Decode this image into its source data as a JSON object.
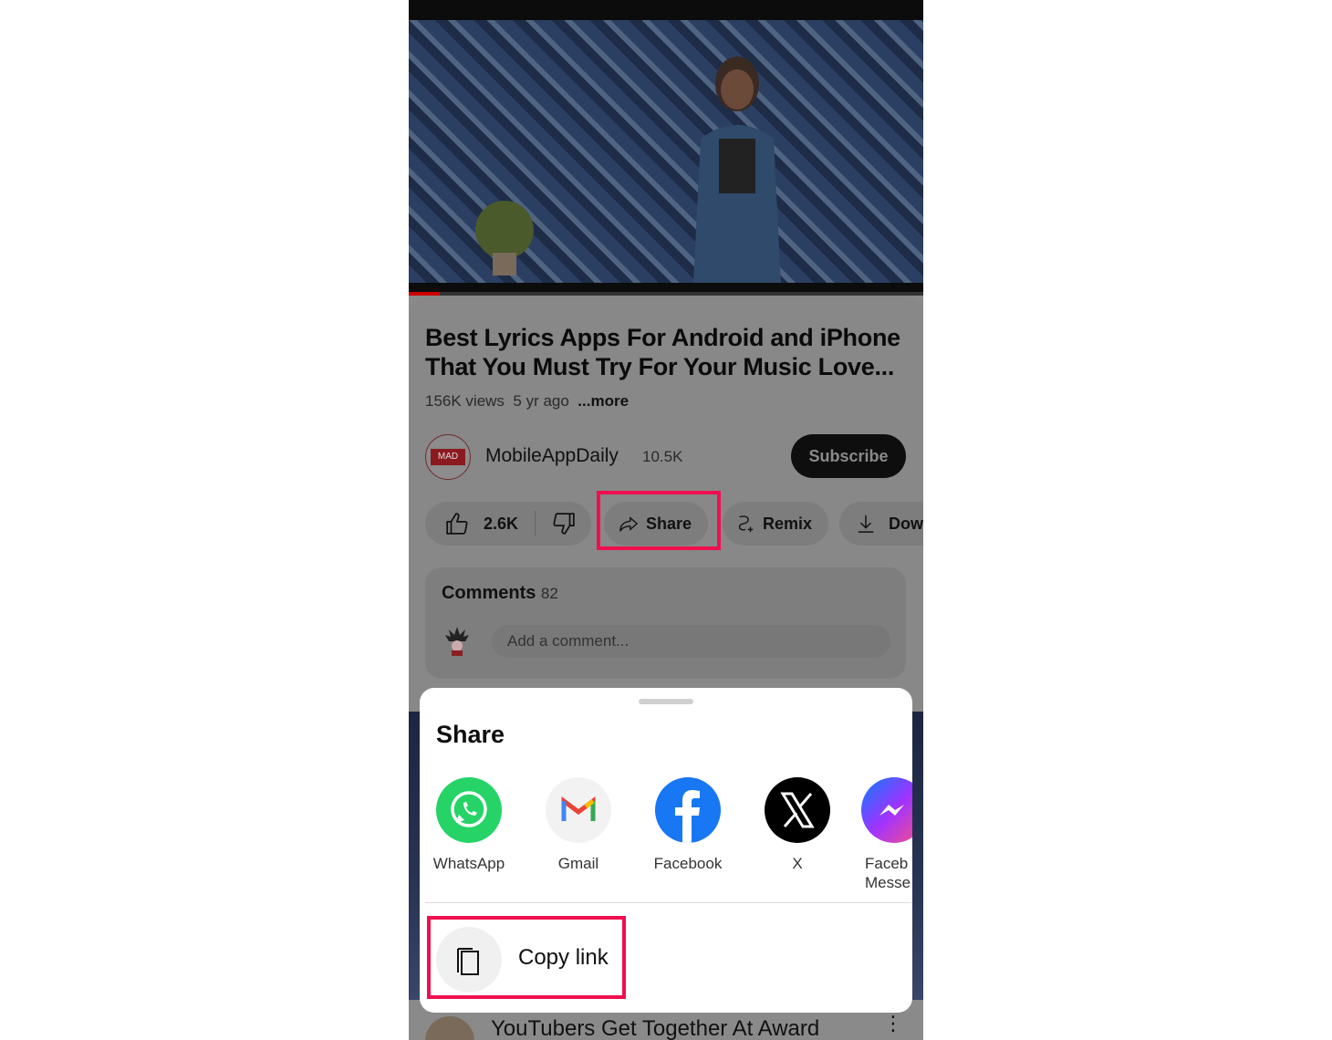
{
  "video": {
    "progress_percent": 6
  },
  "details": {
    "title": "Best Lyrics Apps For Android and iPhone That You Must Try For Your Music Love...",
    "views": "156K views",
    "age": "5 yr ago",
    "more": "...more"
  },
  "channel": {
    "logo_text": "MAD",
    "name": "MobileAppDaily",
    "subscribers": "10.5K",
    "subscribe_label": "Subscribe"
  },
  "actions": {
    "likes": "2.6K",
    "share": "Share",
    "remix": "Remix",
    "download": "Dow"
  },
  "comments": {
    "label": "Comments",
    "count": "82",
    "placeholder": "Add a comment..."
  },
  "share_sheet": {
    "title": "Share",
    "apps": [
      {
        "label": "WhatsApp",
        "icon": "whatsapp-icon",
        "color": "#25d366"
      },
      {
        "label": "Gmail",
        "icon": "gmail-icon",
        "color": "#ea4335"
      },
      {
        "label": "Facebook",
        "icon": "facebook-icon",
        "color": "#1877f2"
      },
      {
        "label": "X",
        "icon": "x-icon",
        "color": "#000000"
      },
      {
        "label": "Faceb\nMesse",
        "icon": "messenger-icon",
        "color": "#a033ff"
      }
    ],
    "copy_link": "Copy link"
  },
  "next_video": {
    "title": "YouTubers Get Together At Award"
  },
  "highlight_color": "#ef0f4f"
}
